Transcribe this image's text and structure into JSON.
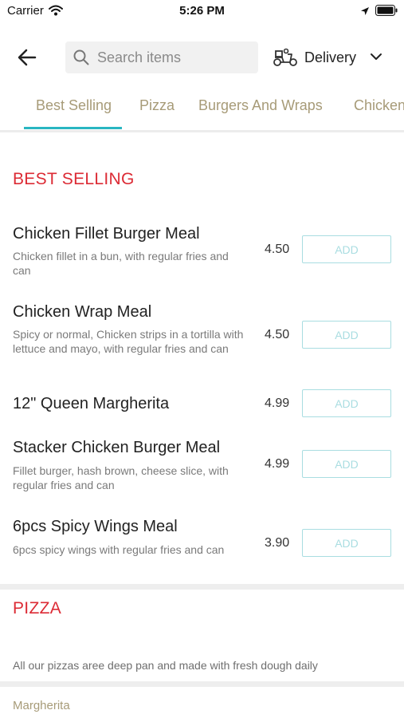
{
  "status_bar": {
    "carrier": "Carrier",
    "time": "5:26 PM"
  },
  "toolbar": {
    "search_placeholder": "Search items",
    "delivery_label": "Delivery"
  },
  "tabs": [
    "Best Selling",
    "Pizza",
    "Burgers And Wraps",
    "Chicken"
  ],
  "sections": {
    "best_selling": {
      "title": "BEST SELLING",
      "items": [
        {
          "name": "Chicken Fillet Burger Meal",
          "desc": "Chicken fillet in a bun, with regular fries and can",
          "price": "4.50",
          "action": "ADD"
        },
        {
          "name": "Chicken Wrap Meal",
          "desc": "Spicy or normal, Chicken strips in a tortilla with lettuce and mayo, with regular fries and can",
          "price": "4.50",
          "action": "ADD"
        },
        {
          "name": "12\" Queen Margherita",
          "desc": "",
          "price": "4.99",
          "action": "ADD"
        },
        {
          "name": "Stacker Chicken Burger Meal",
          "desc": "Fillet burger, hash brown, cheese slice, with regular fries and can",
          "price": "4.99",
          "action": "ADD"
        },
        {
          "name": "6pcs Spicy Wings Meal",
          "desc": "6pcs spicy wings with regular fries and can",
          "price": "3.90",
          "action": "ADD"
        }
      ]
    },
    "pizza": {
      "title": "PIZZA",
      "note": "All our pizzas aree deep pan and made with fresh dough daily",
      "subitems": [
        "Margherita"
      ]
    }
  },
  "colors": {
    "accent": "#29b6c2",
    "section_title": "#dc2b35",
    "tab_text": "#a79b78",
    "add_border": "#a9dde1"
  }
}
